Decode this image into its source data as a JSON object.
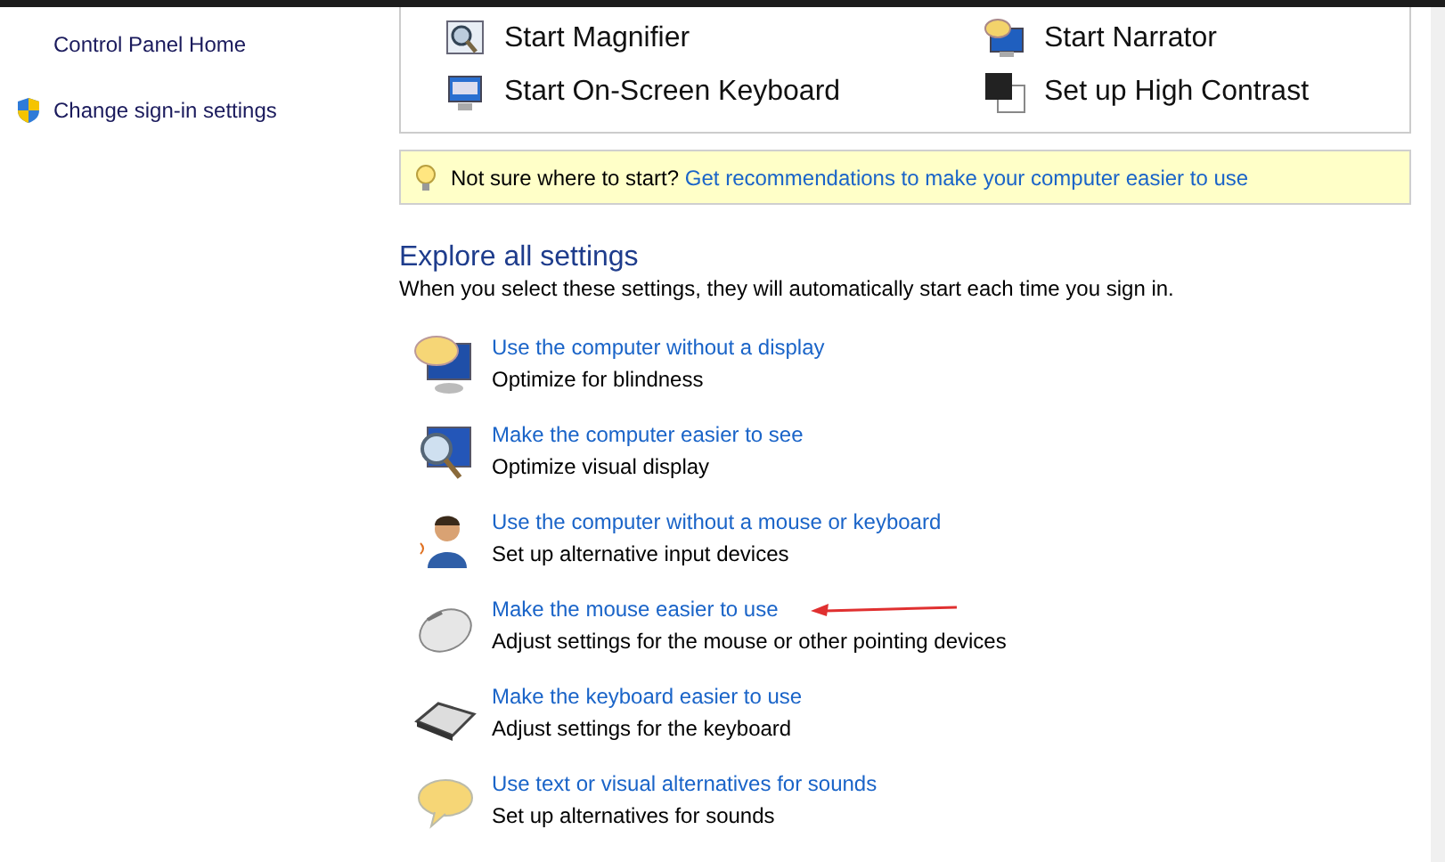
{
  "sidebar": {
    "items": [
      {
        "label": "Control Panel Home",
        "kind": "plain"
      },
      {
        "label": "Change sign-in settings",
        "kind": "shield"
      }
    ]
  },
  "quick_access": [
    {
      "label": "Start Magnifier"
    },
    {
      "label": "Start Narrator"
    },
    {
      "label": "Start On-Screen Keyboard"
    },
    {
      "label": "Set up High Contrast"
    }
  ],
  "tip": {
    "text": "Not sure where to start?",
    "link": "Get recommendations to make your computer easier to use"
  },
  "explore": {
    "title": "Explore all settings",
    "subtitle": "When you select these settings, they will automatically start each time you sign in.",
    "items": [
      {
        "link": "Use the computer without a display",
        "description": "Optimize for blindness",
        "annotated": false
      },
      {
        "link": "Make the computer easier to see",
        "description": "Optimize visual display",
        "annotated": false
      },
      {
        "link": "Use the computer without a mouse or keyboard",
        "description": "Set up alternative input devices",
        "annotated": false
      },
      {
        "link": "Make the mouse easier to use",
        "description": "Adjust settings for the mouse or other pointing devices",
        "annotated": true
      },
      {
        "link": "Make the keyboard easier to use",
        "description": "Adjust settings for the keyboard",
        "annotated": false
      },
      {
        "link": "Use text or visual alternatives for sounds",
        "description": "Set up alternatives for sounds",
        "annotated": false
      }
    ]
  }
}
